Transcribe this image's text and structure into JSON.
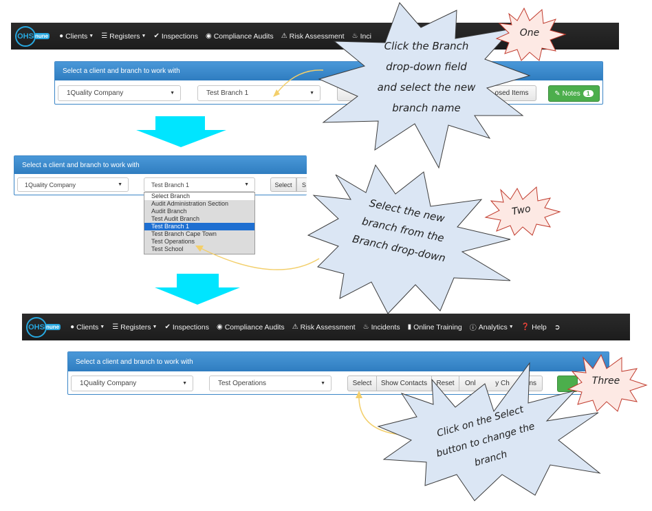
{
  "logo": {
    "ohs": "OHS",
    "nune": "nune"
  },
  "nav": [
    {
      "label": "Clients",
      "icon": "user-icon",
      "caret": true
    },
    {
      "label": "Registers",
      "icon": "list-icon",
      "caret": true
    },
    {
      "label": "Inspections",
      "icon": "check-icon",
      "caret": false
    },
    {
      "label": "Compliance Audits",
      "icon": "eye-icon",
      "caret": false
    },
    {
      "label": "Risk Assessment",
      "icon": "warning-icon",
      "caret": false
    },
    {
      "label": "Incidents",
      "icon": "fire-icon",
      "caret": false
    },
    {
      "label": "Online Training",
      "icon": "book-icon",
      "caret": false
    },
    {
      "label": "Analytics",
      "icon": "info-icon",
      "caret": true
    },
    {
      "label": "Help",
      "icon": "question-icon",
      "caret": false
    }
  ],
  "nav_top_partial": "Inci",
  "panel_heading": "Select a client and branch to work with",
  "step1": {
    "client_value": "1Quality Company",
    "branch_value": "Test Branch 1",
    "closed_items_partial": "osed Items",
    "notes_label": "Notes",
    "notes_count": "1"
  },
  "step2": {
    "client_value": "1Quality Company",
    "branch_value": "Test Branch 1",
    "select_label": "Select",
    "next_partial": "S",
    "options": [
      "Select Branch",
      "Audit Administration Section",
      "Audit Branch",
      "Test Audit Branch",
      "Test Branch 1",
      "Test Branch Cape Town",
      "Test Operations",
      "Test School"
    ],
    "highlighted_index": 4
  },
  "step3": {
    "client_value": "1Quality Company",
    "branch_value": "Test Operations",
    "buttons": [
      "Select",
      "Show Contacts",
      "Reset"
    ],
    "only_partial": "Onl",
    "only_tail": "y Ch",
    "only_end": "ns"
  },
  "callouts": {
    "c1": [
      "Click the Branch",
      "drop-down field",
      "and select the new",
      "branch name"
    ],
    "c2": [
      "Select the new",
      "branch from the",
      "Branch drop-down"
    ],
    "c3": [
      "Click on the Select",
      "button to change the",
      "branch"
    ]
  },
  "bursts": {
    "one": "One",
    "two": "Two",
    "three": "Three"
  },
  "colors": {
    "arrow": "#00e5ff",
    "callout_fill": "#dbe6f4",
    "burst_fill": "#fde9e4",
    "burst_stroke": "#c0392b",
    "connector": "#f3cf6b"
  }
}
